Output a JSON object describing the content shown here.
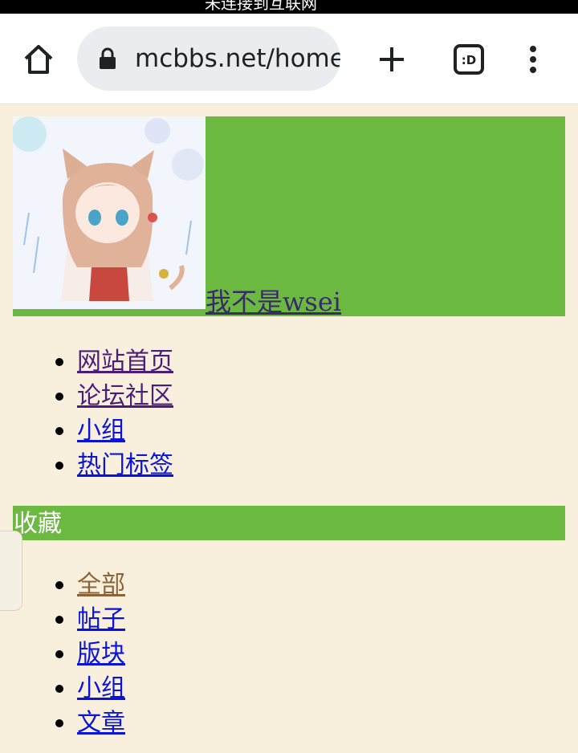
{
  "status_bar": {
    "text": "未连接到互联网"
  },
  "browser": {
    "url": "mcbbs.net/home",
    "tab_count_label": ":D",
    "icons": [
      "home-icon",
      "lock-icon",
      "plus-icon",
      "tabs-icon",
      "more-vert-icon"
    ]
  },
  "profile": {
    "username": "我不是wsei"
  },
  "nav": {
    "items": [
      {
        "label": "网站首页"
      },
      {
        "label": "论坛社区"
      },
      {
        "label": "小组"
      },
      {
        "label": "热门标签"
      }
    ]
  },
  "favorites": {
    "title": "收藏",
    "items": [
      {
        "label": "全部"
      },
      {
        "label": "帖子"
      },
      {
        "label": "版块"
      },
      {
        "label": "小组"
      },
      {
        "label": "文章"
      }
    ]
  },
  "colors": {
    "accent_green": "#6cb942",
    "page_bg": "#f8f0dc",
    "link_blue": "#0a13d8",
    "link_visited": "#4b1d7a",
    "link_active": "#8a6338"
  }
}
